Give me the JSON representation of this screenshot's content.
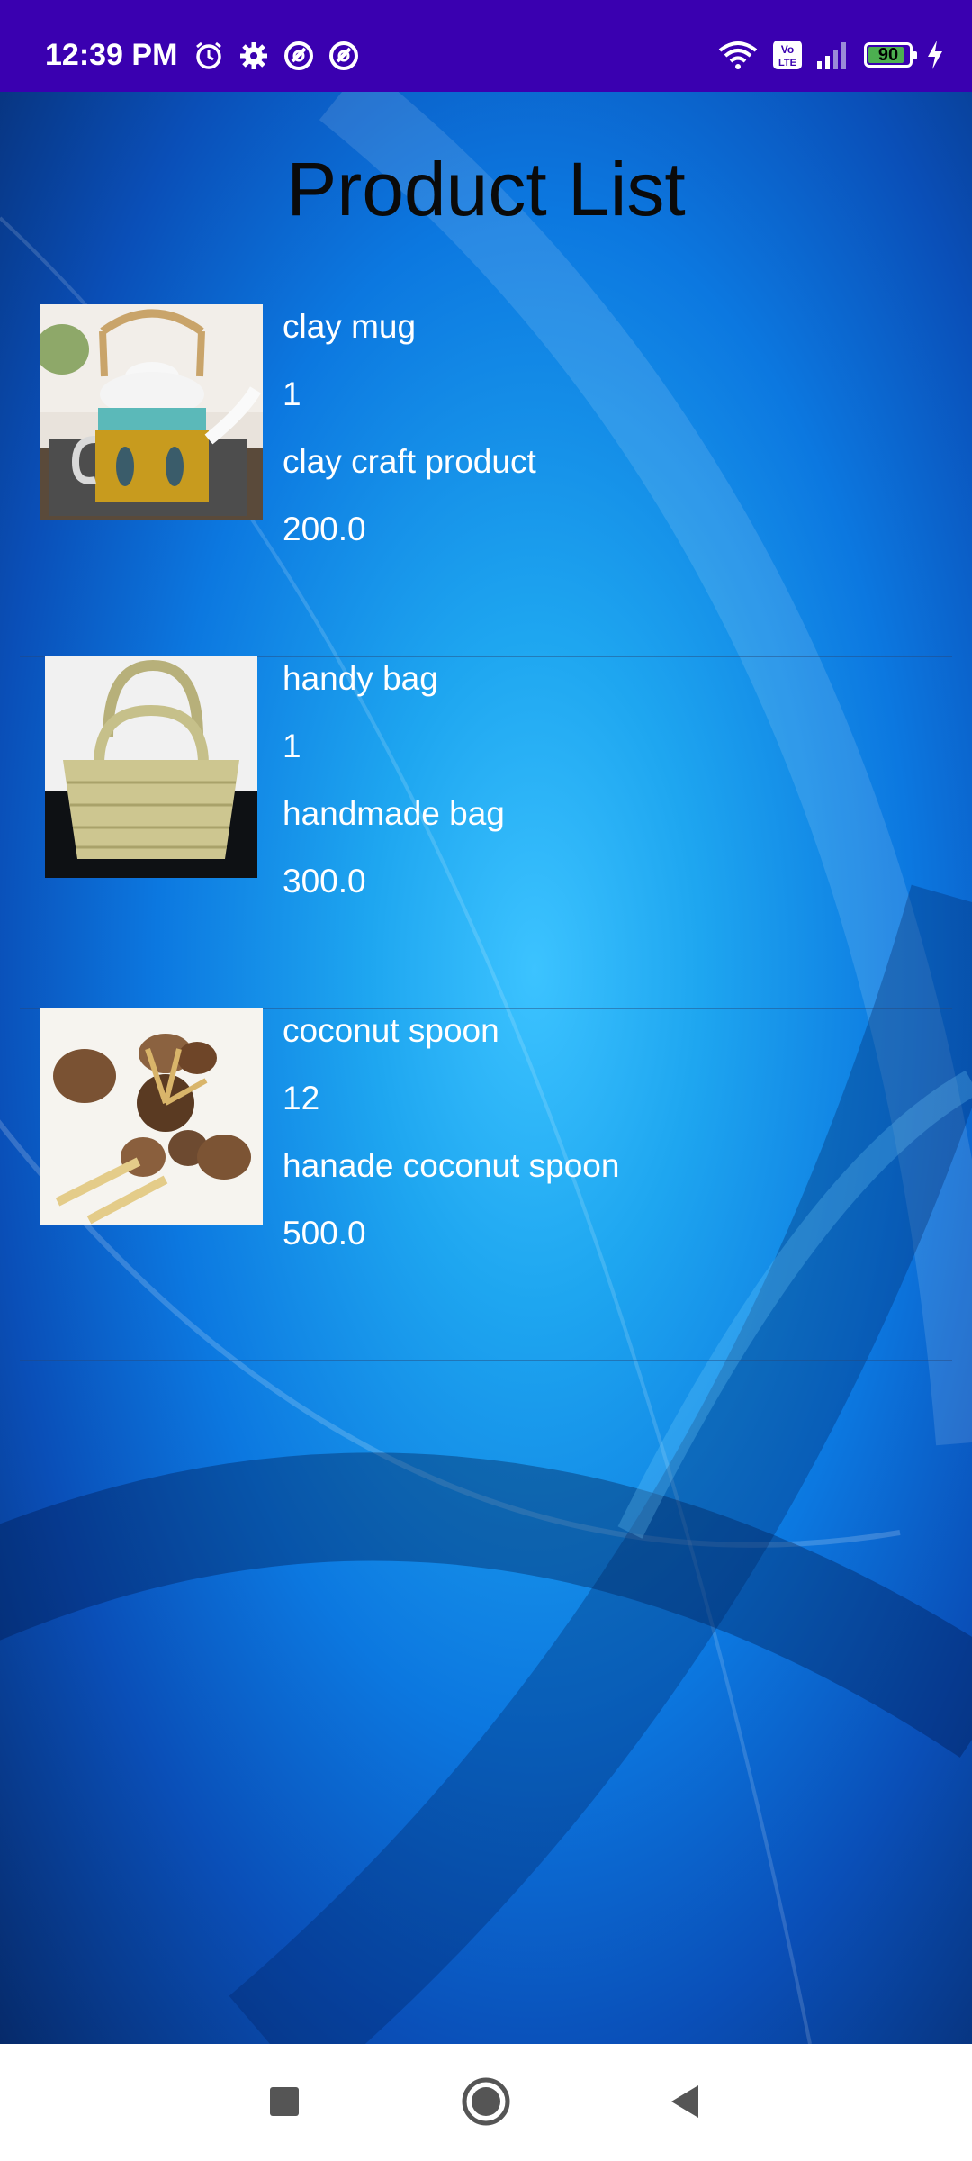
{
  "status_bar": {
    "time": "12:39 PM",
    "battery": "90",
    "battery_level": 0.9,
    "left_icons": [
      "alarm-icon",
      "gear-icon",
      "vpn-icon",
      "vpn-icon"
    ],
    "right_icons": [
      "wifi-icon",
      "volte-icon",
      "signal-icon",
      "battery-icon",
      "charging-icon"
    ]
  },
  "page": {
    "title": "Product List"
  },
  "products": [
    {
      "name": "clay mug",
      "quantity": "1",
      "description": "clay craft product",
      "price": "200.0",
      "image": "teapot-image"
    },
    {
      "name": "handy bag",
      "quantity": "1",
      "description": "handmade bag",
      "price": "300.0",
      "image": "basket-bag-image"
    },
    {
      "name": "coconut spoon",
      "quantity": "12",
      "description": "hanade coconut spoon",
      "price": "500.0",
      "image": "coconut-spoons-image"
    }
  ],
  "nav": {
    "icons": [
      "recents-square-icon",
      "home-circle-icon",
      "back-triangle-icon"
    ]
  },
  "colors": {
    "status_bar": "#3a00b0",
    "background": "#0b5fd0",
    "text": "#ffffff",
    "title": "#0a0a0a"
  }
}
